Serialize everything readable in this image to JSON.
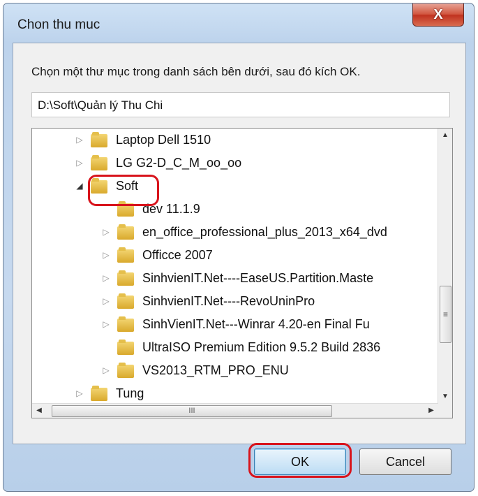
{
  "window": {
    "title": "Chon thu muc",
    "close_label": "X"
  },
  "dialog": {
    "instruction": "Chọn một thư mục trong danh sách bên dưới, sau đó kích OK.",
    "path": "D:\\Soft\\Quản lý Thu Chi"
  },
  "tree": {
    "items": [
      {
        "label": "Laptop Dell 1510"
      },
      {
        "label": "LG G2-D_C_M_oo_oo"
      },
      {
        "label": "Soft"
      },
      {
        "label": "dev 11.1.9"
      },
      {
        "label": "en_office_professional_plus_2013_x64_dvd"
      },
      {
        "label": "Officce 2007"
      },
      {
        "label": "SinhvienIT.Net----EaseUS.Partition.Maste"
      },
      {
        "label": "SinhvienIT.Net----RevoUninPro"
      },
      {
        "label": "SinhVienIT.Net---Winrar 4.20-en Final Fu"
      },
      {
        "label": "UltraISO Premium Edition 9.5.2 Build 2836"
      },
      {
        "label": "VS2013_RTM_PRO_ENU"
      },
      {
        "label": "Tung"
      }
    ],
    "vthumb_grip": "≡",
    "hthumb_grip": "III"
  },
  "buttons": {
    "ok": "OK",
    "cancel": "Cancel"
  }
}
